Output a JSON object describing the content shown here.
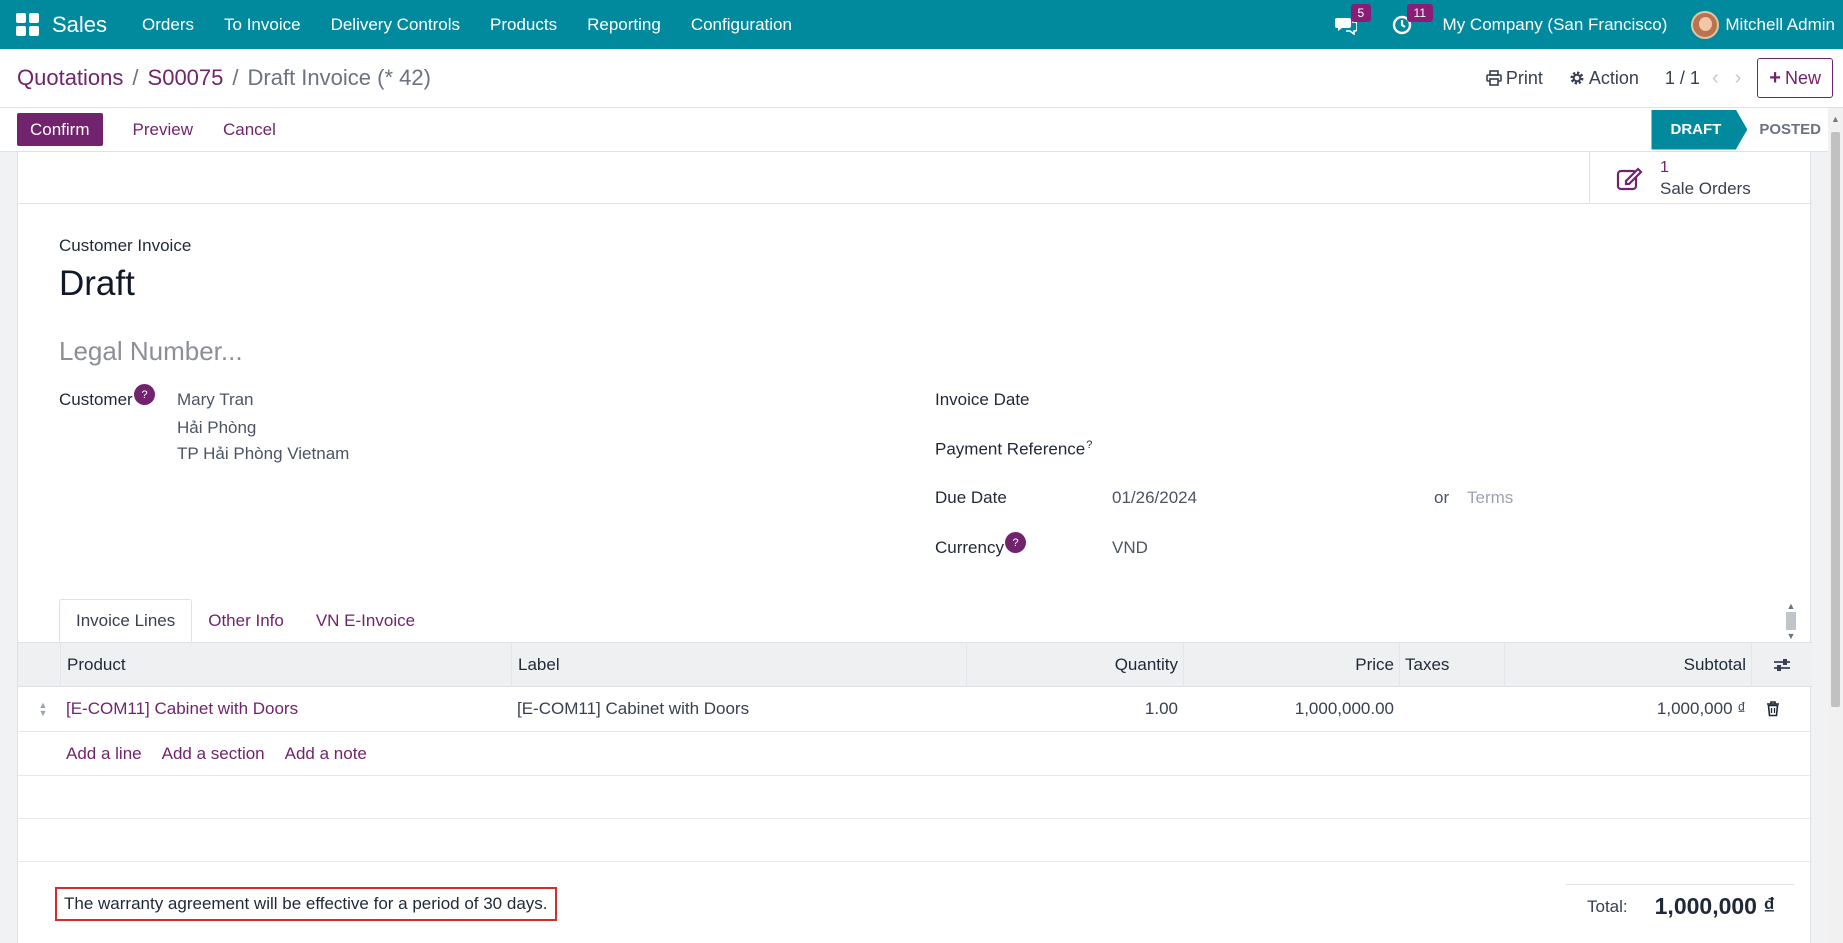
{
  "navbar": {
    "apps_icon": "grid-icon",
    "brand": "Sales",
    "menu": [
      "Orders",
      "To Invoice",
      "Delivery Controls",
      "Products",
      "Reporting",
      "Configuration"
    ],
    "messages_badge": "5",
    "activities_badge": "11",
    "company": "My Company (San Francisco)",
    "user": "Mitchell Admin",
    "color": "#018a9e"
  },
  "breadcrumb": {
    "items": [
      "Quotations",
      "S00075"
    ],
    "separator": "/",
    "current": "Draft Invoice (* 42)"
  },
  "control": {
    "print_label": "Print",
    "action_label": "Action",
    "pager": "1 / 1",
    "prev": "‹",
    "next": "›",
    "new_label": "New",
    "new_icon": "+"
  },
  "statusbar": {
    "confirm": "Confirm",
    "preview": "Preview",
    "cancel": "Cancel",
    "stages": [
      "DRAFT",
      "POSTED"
    ],
    "active_stage": "DRAFT"
  },
  "smart_button": {
    "value": "1",
    "label": "Sale Orders",
    "icon": "edit-icon"
  },
  "form": {
    "doc_type": "Customer Invoice",
    "title": "Draft",
    "legal_number_placeholder": "Legal Number...",
    "customer_label": "Customer",
    "help_mark": "?",
    "customer_lines": [
      "Mary Tran",
      "Hải Phòng",
      "TP Hải Phòng Vietnam"
    ],
    "invoice_date_label": "Invoice Date",
    "payment_ref_label": "Payment Reference",
    "payment_ref_sup": "?",
    "due_date_label": "Due Date",
    "due_date": "01/26/2024",
    "or": "or",
    "terms_placeholder": "Terms",
    "currency_label": "Currency",
    "currency": "VND"
  },
  "tabs": [
    "Invoice Lines",
    "Other Info",
    "VN E-Invoice"
  ],
  "table": {
    "columns": [
      "Product",
      "Label",
      "Quantity",
      "Price",
      "Taxes",
      "Subtotal"
    ],
    "rows": [
      {
        "product": "[E-COM11] Cabinet with Doors",
        "label": "[E-COM11] Cabinet with Doors",
        "quantity": "1.00",
        "price": "1,000,000.00",
        "taxes": "",
        "subtotal": "1,000,000 ₫"
      }
    ],
    "add_links": [
      "Add a line",
      "Add a section",
      "Add a note"
    ]
  },
  "footer": {
    "narration": "The warranty agreement will be effective for a period of 30 days.",
    "total_label": "Total:",
    "total_value": "1,000,000 ₫"
  }
}
